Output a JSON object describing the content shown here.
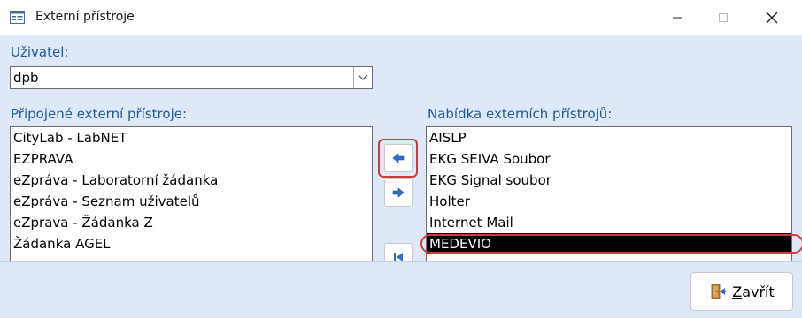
{
  "window": {
    "title": "Externí přístroje",
    "controls": {
      "minimize": "minimize",
      "maximize": "maximize",
      "close": "close"
    }
  },
  "user": {
    "label": "Uživatel:",
    "value": "dpb"
  },
  "connected": {
    "label": "Připojené externí přístroje:",
    "items": [
      "CityLab - LabNET",
      "EZPRAVA",
      "eZpráva - Laboratorní žádanka",
      "eZpráva - Seznam uživatelů",
      "eZprava - Žádanka Z",
      "Žádanka AGEL"
    ]
  },
  "available": {
    "label": "Nabídka externích přístrojů:",
    "items": [
      "AISLP",
      "EKG SEIVA Soubor",
      "EKG Signal soubor",
      "Holter",
      "Internet Mail",
      "MEDEVIO"
    ],
    "selected_index": 5
  },
  "buttons": {
    "close_prefix": "",
    "close_underlined": "Z",
    "close_rest": "avřít"
  },
  "icons": {
    "app": "form-icon",
    "move_left": "arrow-left-icon",
    "move_right": "arrow-right-icon",
    "move_first": "first-icon",
    "close_button": "door-exit-icon"
  },
  "colors": {
    "label_blue": "#1f5a9b",
    "panel_bg": "#dfe8f6",
    "annotation_red": "#d13a3a",
    "selected_bg": "#000000"
  }
}
